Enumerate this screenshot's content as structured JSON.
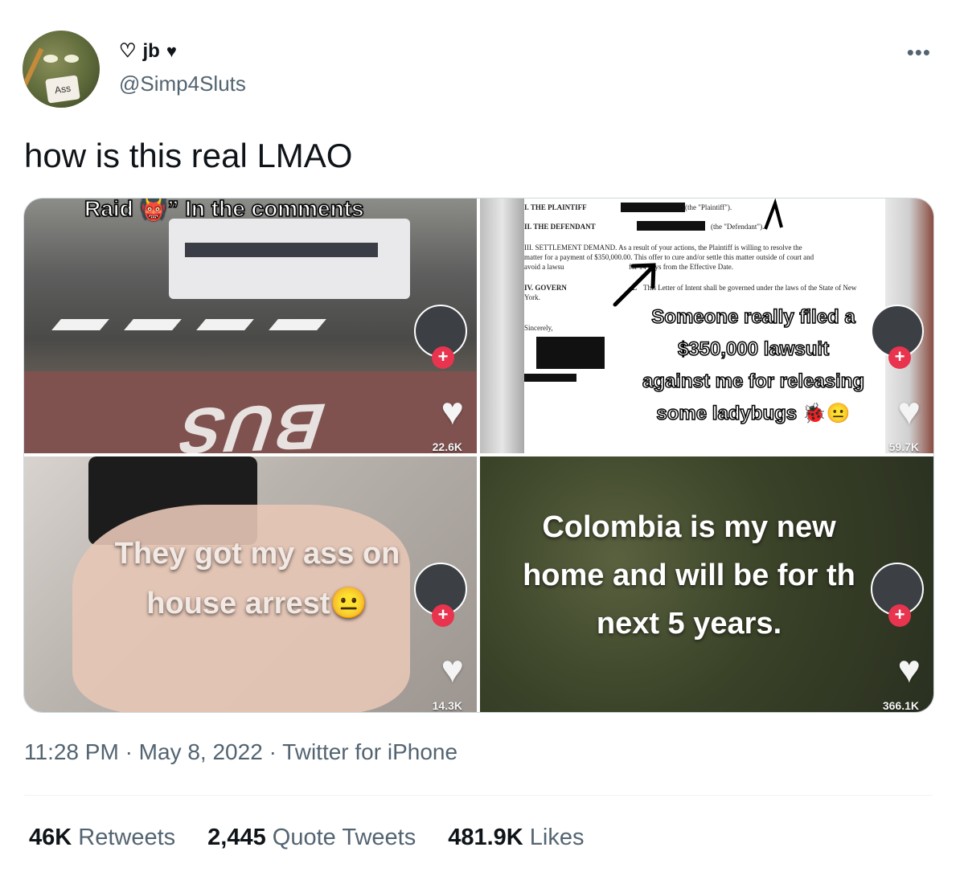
{
  "author": {
    "display_name": "jb",
    "handle": "@Simp4Sluts",
    "avatar_apron_text": "Ass"
  },
  "tweet": {
    "text": "how is this real LMAO",
    "time": "11:28 PM",
    "date": "May 8, 2022",
    "source": "Twitter for iPhone"
  },
  "media": [
    {
      "caption": "Raid 👹” In the comments",
      "road_text": "BUS",
      "likes": "22.6K"
    },
    {
      "doc_lines": [
        "I. THE PLAINTIFF",
        "(the \"Plaintiff\").",
        "II. THE DEFENDANT",
        "(the \"Defendant\").",
        "III. SETTLEMENT DEMAND. As a result of your actions, the Plaintiff is willing to resolve the",
        "matter for a payment of $350,000.00. This offer to cure and/or settle this matter outside of court and",
        "avoid a lawsu",
        "for 14 days from the Effective Date.",
        "IV. GOVERN",
        "L",
        "This Letter of Intent shall be governed under the laws of the State of New",
        "York.",
        "Sincerely,"
      ],
      "caption_lines": [
        "Someone really filed a",
        "$350,000 lawsuit",
        "against me for releasing",
        "some ladybugs 🐞😐"
      ],
      "likes": "59.7K"
    },
    {
      "caption_lines": [
        "They got my ass on",
        "house arrest😐"
      ],
      "likes": "14.3K"
    },
    {
      "caption_lines": [
        "Colombia is my new",
        "home and will be for th",
        "next 5 years."
      ],
      "likes": "366.1K"
    }
  ],
  "stats": {
    "retweets_count": "46K",
    "retweets_label": "Retweets",
    "quotes_count": "2,445",
    "quotes_label": "Quote Tweets",
    "likes_count": "481.9K",
    "likes_label": "Likes"
  },
  "icons": {
    "heart_outline": "heart-outline-icon",
    "heart_solid": "heart-solid-icon",
    "more": "more-icon",
    "tiktok_plus": "plus-icon",
    "tiktok_heart": "heart-icon"
  },
  "colors": {
    "text_primary": "#0f1419",
    "text_secondary": "#536471",
    "tiktok_red": "#e8344e"
  }
}
